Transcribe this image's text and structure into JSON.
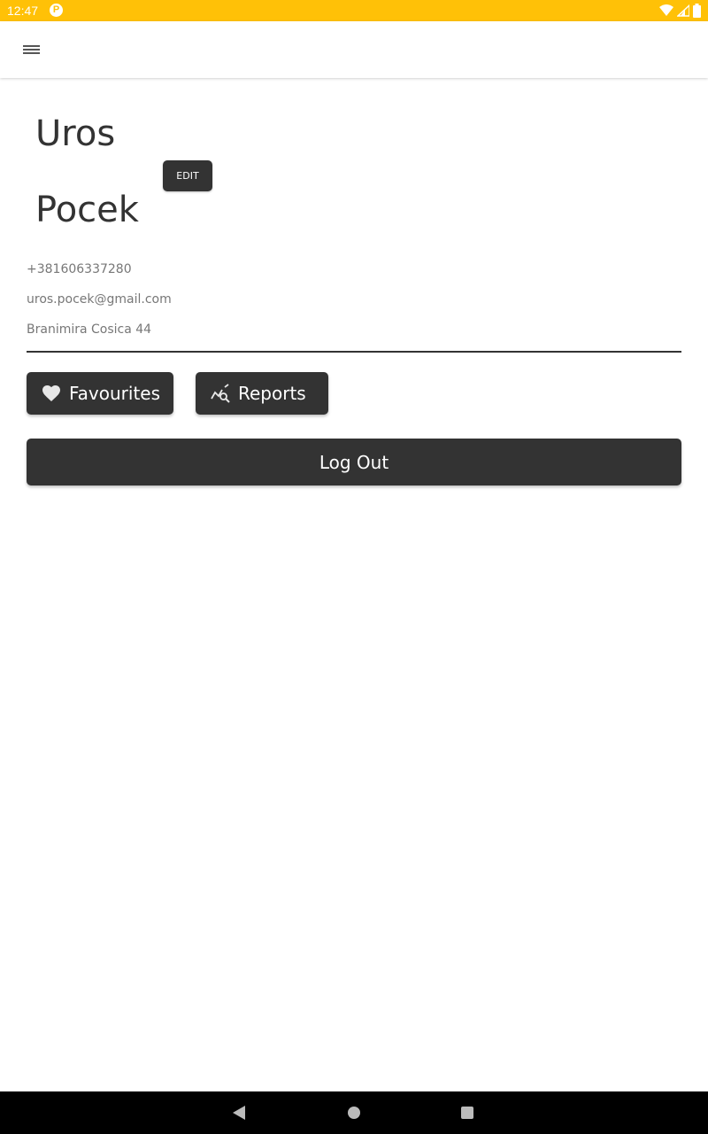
{
  "status_bar": {
    "time": "12:47",
    "app_icon_glyph": "P",
    "bg_color": "#FFC107"
  },
  "profile": {
    "first_name": "Uros",
    "last_name": "Pocek",
    "edit_label": "EDIT",
    "phone": "+381606337280",
    "email": "uros.pocek@gmail.com",
    "address": "Branimira Cosica 44"
  },
  "actions": {
    "favourites_label": "Favourites",
    "favourites_icon": "heart-icon",
    "reports_label": "Reports",
    "reports_icon": "chart-search-icon",
    "logout_label": "Log Out"
  },
  "theme": {
    "accent": "#FFC107",
    "button_bg": "#333333",
    "text": "#333333"
  }
}
